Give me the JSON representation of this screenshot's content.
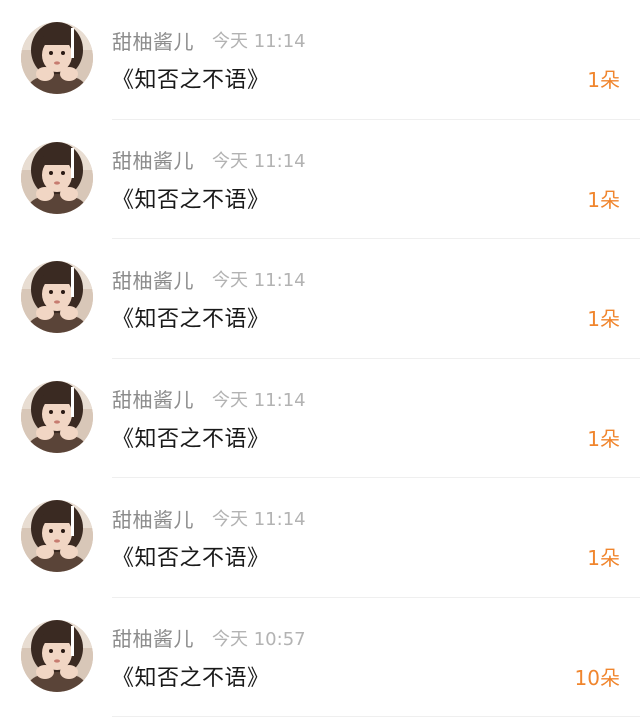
{
  "messages": [
    {
      "username": "甜柚酱儿",
      "time": "今天 11:14",
      "text": "《知否之不语》",
      "count": "1朵"
    },
    {
      "username": "甜柚酱儿",
      "time": "今天 11:14",
      "text": "《知否之不语》",
      "count": "1朵"
    },
    {
      "username": "甜柚酱儿",
      "time": "今天 11:14",
      "text": "《知否之不语》",
      "count": "1朵"
    },
    {
      "username": "甜柚酱儿",
      "time": "今天 11:14",
      "text": "《知否之不语》",
      "count": "1朵"
    },
    {
      "username": "甜柚酱儿",
      "time": "今天 11:14",
      "text": "《知否之不语》",
      "count": "1朵"
    },
    {
      "username": "甜柚酱儿",
      "time": "今天 10:57",
      "text": "《知否之不语》",
      "count": "10朵"
    }
  ],
  "colors": {
    "accent": "#f0852d",
    "username": "#8c8c8c",
    "time": "#b3b3b3",
    "text": "#1a1a1a"
  },
  "icons": {
    "avatar": "user-avatar-photo"
  }
}
